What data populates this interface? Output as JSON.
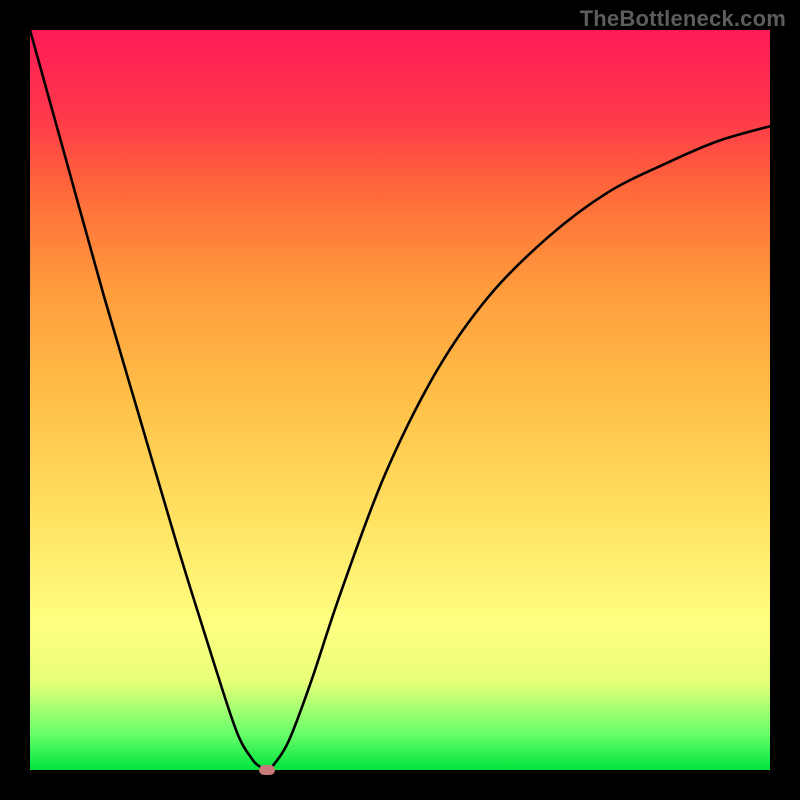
{
  "watermark": "TheBottleneck.com",
  "chart_data": {
    "type": "line",
    "title": "",
    "xlabel": "",
    "ylabel": "",
    "xlim": [
      0,
      100
    ],
    "ylim": [
      0,
      100
    ],
    "grid": false,
    "legend": false,
    "series": [
      {
        "name": "bottleneck-curve",
        "x": [
          0,
          5,
          10,
          15,
          20,
          25,
          28,
          30,
          31,
          32,
          33,
          35,
          38,
          42,
          48,
          55,
          62,
          70,
          78,
          86,
          93,
          100
        ],
        "y": [
          100,
          82,
          64,
          47,
          30,
          14,
          5,
          1.5,
          0.5,
          0,
          0.8,
          4,
          12,
          24,
          40,
          54,
          64,
          72,
          78,
          82,
          85,
          87
        ]
      }
    ],
    "annotations": [
      {
        "type": "min-marker",
        "x": 32,
        "y": 0
      }
    ],
    "background_gradient": {
      "direction": "bottom-to-top",
      "stops": [
        {
          "pct": 0,
          "color": "#00e43c"
        },
        {
          "pct": 5,
          "color": "#6aff6b"
        },
        {
          "pct": 12,
          "color": "#e8ff7a"
        },
        {
          "pct": 20,
          "color": "#ffff80"
        },
        {
          "pct": 35,
          "color": "#ffe060"
        },
        {
          "pct": 50,
          "color": "#ffc048"
        },
        {
          "pct": 65,
          "color": "#ff9c3c"
        },
        {
          "pct": 78,
          "color": "#ff6a3a"
        },
        {
          "pct": 88,
          "color": "#ff3a4a"
        },
        {
          "pct": 100,
          "color": "#ff1a56"
        }
      ]
    }
  }
}
